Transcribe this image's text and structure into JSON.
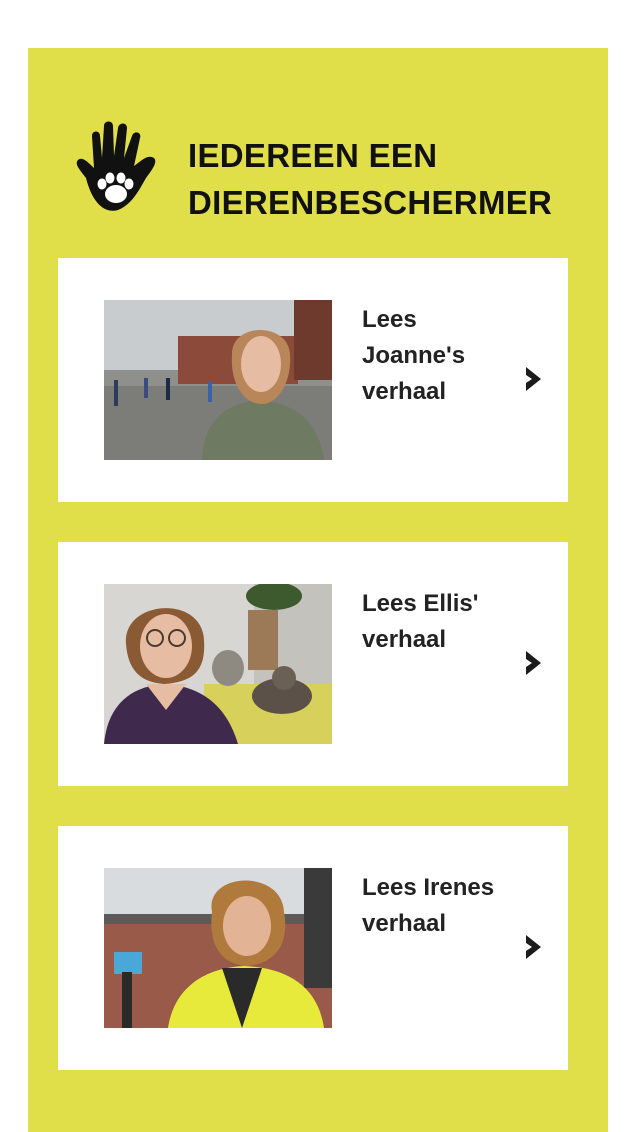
{
  "header": {
    "title_line1": "IEDEREEN EEN",
    "title_line2": "DIERENBESCHERMER",
    "icon": "hand-paw-icon"
  },
  "colors": {
    "panel_background": "#e0df4a",
    "card_background": "#ffffff",
    "text": "#222222"
  },
  "stories": [
    {
      "label": "Lees Joanne's verhaal",
      "photo": "joanne-photo",
      "icon": "chevron-right-icon"
    },
    {
      "label": "Lees Ellis' verhaal",
      "photo": "ellis-photo",
      "icon": "chevron-right-icon"
    },
    {
      "label": "Lees Irenes verhaal",
      "photo": "irene-photo",
      "icon": "chevron-right-icon"
    }
  ]
}
